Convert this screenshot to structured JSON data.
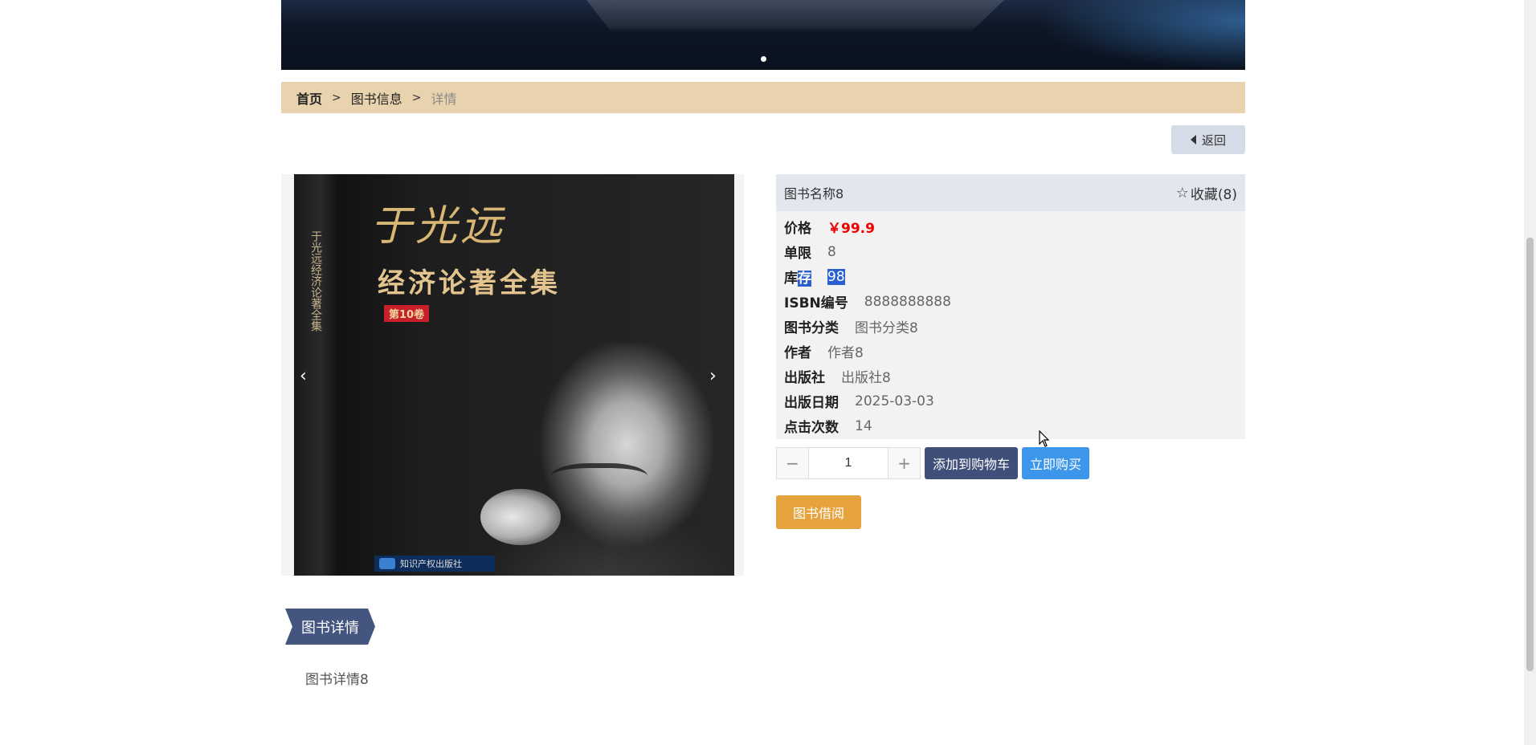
{
  "breadcrumb": {
    "home": "首页",
    "sep": ">",
    "section": "图书信息",
    "current": "详情"
  },
  "back_button": "返回",
  "gallery": {
    "cover_author": "于光远",
    "cover_title": "经济论著全集",
    "cover_volume": "第10卷",
    "cover_spine": "于光远经济论著全集",
    "cover_publisher": "知识产权出版社",
    "prev_icon": "‹",
    "next_icon": "›"
  },
  "book": {
    "name": "图书名称8",
    "favorite": "收藏(8)",
    "price_label": "价格",
    "price": "￥99.9",
    "limit_label": "单限",
    "limit": "8",
    "stock_label_a": "库",
    "stock_label_b": "存",
    "stock": "98",
    "isbn_label": "ISBN编号",
    "isbn": "8888888888",
    "category_label": "图书分类",
    "category": "图书分类8",
    "author_label": "作者",
    "author": "作者8",
    "publisher_label": "出版社",
    "publisher": "出版社8",
    "date_label": "出版日期",
    "date": "2025-03-03",
    "clicks_label": "点击次数",
    "clicks": "14"
  },
  "purchase": {
    "minus": "−",
    "plus": "+",
    "quantity": "1",
    "add_to_cart": "添加到购物车",
    "buy_now": "立即购买",
    "borrow": "图书借阅"
  },
  "details": {
    "tab": "图书详情",
    "content": "图书详情8"
  },
  "colors": {
    "breadcrumb_bg": "#e9d3ae",
    "price": "#e00000",
    "cart_button": "#3f4f79",
    "buy_button": "#3c97ea",
    "borrow_button": "#e6a23c"
  }
}
